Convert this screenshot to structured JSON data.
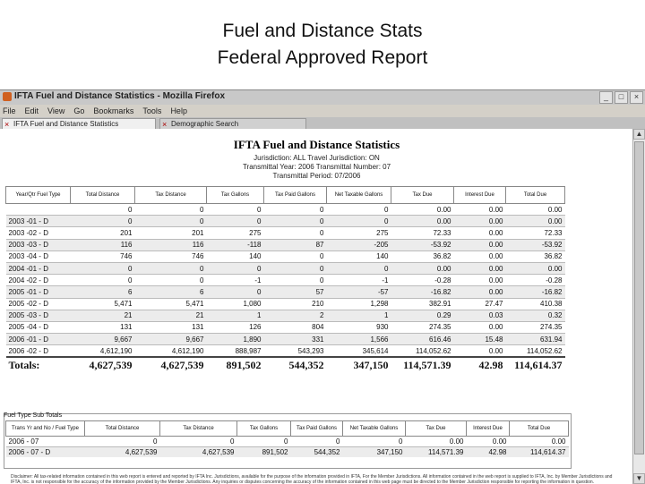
{
  "slide": {
    "title_line1": "Fuel and Distance Stats",
    "title_line2": "Federal Approved Report"
  },
  "window": {
    "title": "IFTA Fuel and Distance Statistics - Mozilla Firefox",
    "buttons": [
      "_",
      "□",
      "×"
    ]
  },
  "menu": [
    "File",
    "Edit",
    "View",
    "Go",
    "Bookmarks",
    "Tools",
    "Help"
  ],
  "tabs": [
    {
      "label": "IFTA Fuel and Distance Statistics",
      "active": true
    },
    {
      "label": "Demographic Search",
      "active": false
    }
  ],
  "report": {
    "title": "IFTA Fuel and Distance Statistics",
    "jurisdiction": "Jurisdiction: ALL    Travel Jurisdiction: ON",
    "transmittal": "Transmittal Year: 2006    Transmittal Number: 07",
    "period": "Transmittal Period: 07/2006",
    "columns": [
      "Year/Qtr Fuel Type",
      "Total Distance",
      "Tax Distance",
      "Tax Gallons",
      "Tax Paid Gallons",
      "Net Taxable Gallons",
      "Tax Due",
      "Interest Due",
      "Total Due"
    ],
    "rows": [
      [
        "",
        "0",
        "0",
        "0",
        "0",
        "0",
        "0.00",
        "0.00",
        "0.00"
      ],
      [
        "2003 -01 - D",
        "0",
        "0",
        "0",
        "0",
        "0",
        "0.00",
        "0.00",
        "0.00"
      ],
      [
        "2003 -02 - D",
        "201",
        "201",
        "275",
        "0",
        "275",
        "72.33",
        "0.00",
        "72.33"
      ],
      [
        "2003 -03 - D",
        "116",
        "116",
        "-118",
        "87",
        "-205",
        "-53.92",
        "0.00",
        "-53.92"
      ],
      [
        "2003 -04 - D",
        "746",
        "746",
        "140",
        "0",
        "140",
        "36.82",
        "0.00",
        "36.82"
      ],
      [
        "2004 -01 - D",
        "0",
        "0",
        "0",
        "0",
        "0",
        "0.00",
        "0.00",
        "0.00"
      ],
      [
        "2004 -02 - D",
        "0",
        "0",
        "-1",
        "0",
        "-1",
        "-0.28",
        "0.00",
        "-0.28"
      ],
      [
        "2005 -01 - D",
        "6",
        "6",
        "0",
        "57",
        "-57",
        "-16.82",
        "0.00",
        "-16.82"
      ],
      [
        "2005 -02 - D",
        "5,471",
        "5,471",
        "1,080",
        "210",
        "1,298",
        "382.91",
        "27.47",
        "410.38"
      ],
      [
        "2005 -03 - D",
        "21",
        "21",
        "1",
        "2",
        "1",
        "0.29",
        "0.03",
        "0.32"
      ],
      [
        "2005 -04 - D",
        "131",
        "131",
        "126",
        "804",
        "930",
        "274.35",
        "0.00",
        "274.35"
      ],
      [
        "2006 -01 - D",
        "9,667",
        "9,667",
        "1,890",
        "331",
        "1,566",
        "616.46",
        "15.48",
        "631.94"
      ],
      [
        "2006 -02 - D",
        "4,612,190",
        "4,612,190",
        "888,987",
        "543,293",
        "345,614",
        "114,052.62",
        "0.00",
        "114,052.62"
      ]
    ],
    "totals": [
      "Totals:",
      "4,627,539",
      "4,627,539",
      "891,502",
      "544,352",
      "347,150",
      "114,571.39",
      "42.98",
      "114,614.37"
    ]
  },
  "subtotals": {
    "title": "Fuel Type Sub Totals",
    "columns": [
      "Trans Yr and No / Fuel Type",
      "Total Distance",
      "Tax Distance",
      "Tax Gallons",
      "Tax Paid Gallons",
      "Net Taxable Gallons",
      "Tax Due",
      "Interest Due",
      "Total Due"
    ],
    "rows": [
      [
        "2006 - 07",
        "0",
        "0",
        "0",
        "0",
        "0",
        "0.00",
        "0.00",
        "0.00"
      ],
      [
        "2006 - 07 - D",
        "4,627,539",
        "4,627,539",
        "891,502",
        "544,352",
        "347,150",
        "114,571.39",
        "42.98",
        "114,614.37"
      ]
    ]
  },
  "disclaimer": "Disclaimer: All tax-related information contained in this web report is entered and reported by IFTA Inc. Jurisdictions, available for the purpose of the information provided in IFTA, For the Member Jurisdictions. All information contained in the web report is supplied to IFTA, Inc. by Member Jurisdictions and IFTA, Inc. is not responsible for the accuracy of the information provided by the Member Jurisdictions. Any inquiries or disputes concerning the accuracy of the information contained in this web page must be directed to the Member Jurisdiction responsible for reporting the information in question."
}
